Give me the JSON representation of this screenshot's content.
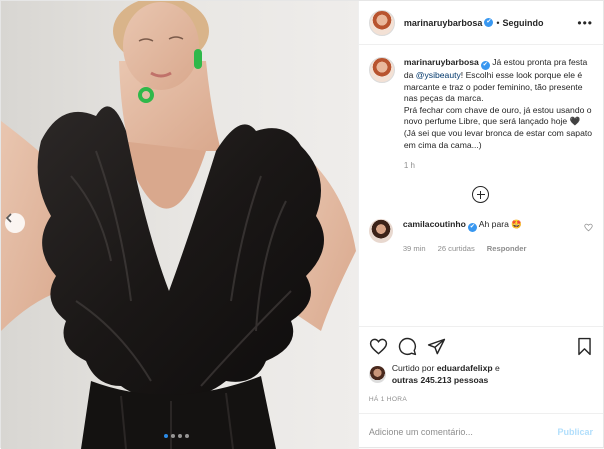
{
  "post": {
    "username": "marinaruybarbosa",
    "verified_mark": "✔",
    "separator": "•",
    "follow_status": "Seguindo",
    "more_glyph": "•••",
    "photo_pager": {
      "total": 4,
      "active_index": 0
    }
  },
  "caption": {
    "username": "marinaruybarbosa",
    "text_before_mention": "Já estou pronta pra festa da ",
    "mention": "@ysibeauty",
    "text_after_mention": "! Escolhi esse look porque ele é marcante e traz o poder feminino, tão presente nas peças da marca.",
    "line2": "Prá fechar com chave de ouro, já estou usando o novo perfume Libre, que será lançado hoje 🖤",
    "line3": "(Já sei que vou levar bronca de estar com sapato em cima da cama...)",
    "time": "1 h"
  },
  "comments": [
    {
      "username": "camilacoutinho",
      "text": "Ah para 🤩",
      "time": "39 min",
      "likes": "26 curtidas",
      "reply_label": "Responder"
    }
  ],
  "likes": {
    "prefix": "Curtido por ",
    "user": "eduardafelixp",
    "middle": " e ",
    "others": "outras 245.213 pessoas"
  },
  "timestamp": "HÁ 1 HORA",
  "add_comment": {
    "placeholder": "Adicione um comentário...",
    "publish_label": "Publicar"
  },
  "colors": {
    "verified": "#3897f0",
    "pager_active": "#2b8ae6",
    "publish_disabled": "#b2dffc",
    "muted_text": "#8e8e8e"
  },
  "icons": [
    "chevron-left-icon",
    "verified-icon",
    "more-icon",
    "add-circle-icon",
    "heart-icon",
    "comment-icon",
    "share-icon",
    "bookmark-icon"
  ]
}
